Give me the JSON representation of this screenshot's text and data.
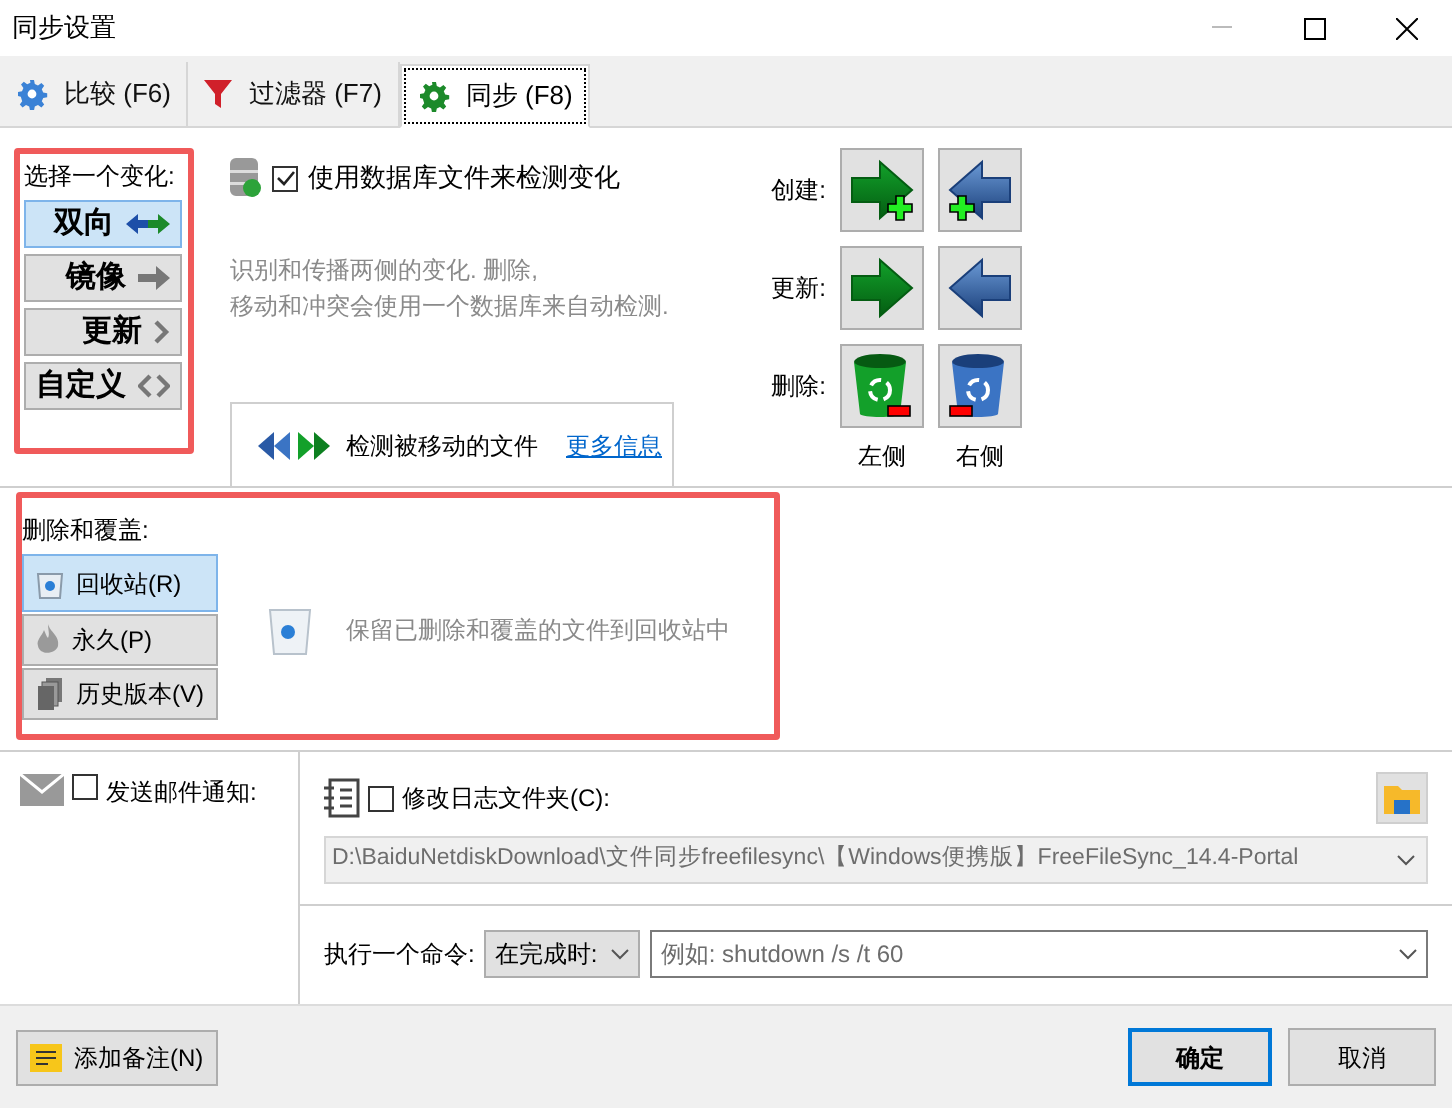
{
  "window": {
    "title": "同步设置"
  },
  "tabs": [
    {
      "label": "比较 (F6)",
      "selected": false,
      "kind": "compare"
    },
    {
      "label": "过滤器 (F7)",
      "selected": false,
      "kind": "filter"
    },
    {
      "label": "同步 (F8)",
      "selected": true,
      "kind": "sync"
    }
  ],
  "variant": {
    "label": "选择一个变化:",
    "options": [
      {
        "label": "双向",
        "selected": true,
        "kind": "two-way"
      },
      {
        "label": "镜像",
        "selected": false,
        "kind": "mirror"
      },
      {
        "label": "更新",
        "selected": false,
        "kind": "update"
      },
      {
        "label": "自定义",
        "selected": false,
        "kind": "custom"
      }
    ]
  },
  "database": {
    "label": "使用数据库文件来检测变化",
    "checked": true
  },
  "description": [
    "识别和传播两侧的变化. 删除,",
    "移动和冲突会使用一个数据库来自动检测."
  ],
  "moved_files": {
    "label": "检测被移动的文件",
    "link": "更多信息"
  },
  "actions": {
    "rows": [
      {
        "label": "创建:",
        "kind": "create"
      },
      {
        "label": "更新:",
        "kind": "update"
      },
      {
        "label": "删除:",
        "kind": "delete"
      }
    ],
    "columns": [
      "左侧",
      "右侧"
    ]
  },
  "deletion": {
    "label": "删除和覆盖:",
    "options": [
      {
        "label": "回收站(R)",
        "selected": true,
        "kind": "recycle"
      },
      {
        "label": "永久(P)",
        "selected": false,
        "kind": "permanent"
      },
      {
        "label": "历史版本(V)",
        "selected": false,
        "kind": "versioning"
      }
    ],
    "description": "保留已删除和覆盖的文件到回收站中"
  },
  "email": {
    "label": "发送邮件通知:",
    "checked": false
  },
  "log": {
    "label": "修改日志文件夹(C):",
    "checked": false,
    "path": "D:\\BaiduNetdiskDownload\\文件同步freefilesync\\【Windows便携版】FreeFileSync_14.4-Portal"
  },
  "command": {
    "label": "执行一个命令:",
    "timing": "在完成时:",
    "placeholder": "例如: shutdown /s /t 60"
  },
  "footer": {
    "note_button": "添加备注(N)",
    "ok": "确定",
    "cancel": "取消"
  }
}
